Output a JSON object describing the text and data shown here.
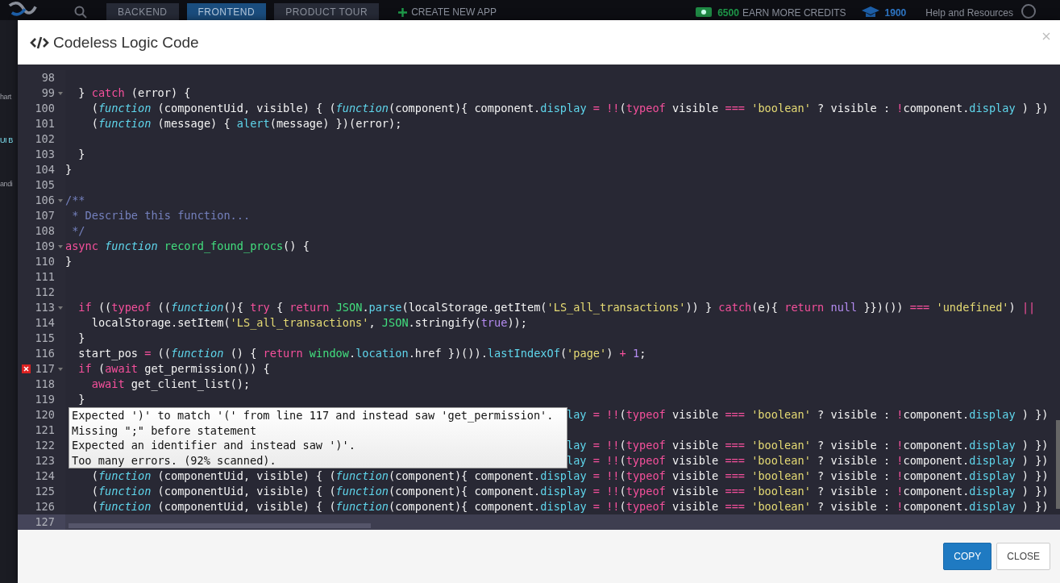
{
  "topbar": {
    "tabs": [
      {
        "label": "BACKEND",
        "selected": false
      },
      {
        "label": "FRONTEND",
        "selected": true
      },
      {
        "label": "PRODUCT TOUR",
        "selected": false
      }
    ],
    "create": "CREATE NEW APP",
    "credits": "6500",
    "earn": "EARN MORE CREDITS",
    "points": "1900",
    "help": "Help and Resources"
  },
  "sidebar": [
    {
      "label": "hart",
      "selected": false
    },
    {
      "label": "UI B",
      "selected": true
    },
    {
      "label": "andi",
      "selected": false
    }
  ],
  "dialog": {
    "title": "Codeless Logic Code",
    "lines": [
      {
        "num": "98"
      },
      {
        "num": "99",
        "fold": true,
        "tokens": [
          {
            "kind": "plain",
            "text": "  } "
          },
          {
            "kind": "keyword",
            "text": "catch"
          },
          {
            "kind": "plain",
            "text": " (error) {"
          }
        ]
      },
      {
        "num": "100",
        "tokens": [
          {
            "kind": "plain",
            "text": "    ("
          },
          {
            "kind": "function",
            "text": "function"
          },
          {
            "kind": "plain",
            "text": " (componentUid, visible) { ("
          },
          {
            "kind": "function",
            "text": "function"
          },
          {
            "kind": "plain",
            "text": "(component){ component."
          },
          {
            "kind": "builtin",
            "text": "display"
          },
          {
            "kind": "keyword",
            "text": " = !!"
          },
          {
            "kind": "plain",
            "text": "("
          },
          {
            "kind": "keyword",
            "text": "typeof"
          },
          {
            "kind": "plain",
            "text": " visible "
          },
          {
            "kind": "keyword",
            "text": "=== "
          },
          {
            "kind": "string",
            "text": "'boolean'"
          },
          {
            "kind": "plain",
            "text": " ? visible : "
          },
          {
            "kind": "keyword",
            "text": "!"
          },
          {
            "kind": "plain",
            "text": "component."
          },
          {
            "kind": "builtin",
            "text": "display"
          },
          {
            "kind": "plain",
            "text": " ) })"
          }
        ]
      },
      {
        "num": "101",
        "tokens": [
          {
            "kind": "plain",
            "text": "    ("
          },
          {
            "kind": "function",
            "text": "function"
          },
          {
            "kind": "plain",
            "text": " (message) { "
          },
          {
            "kind": "builtin",
            "text": "alert"
          },
          {
            "kind": "plain",
            "text": "(message) })(error);"
          }
        ]
      },
      {
        "num": "102"
      },
      {
        "num": "103",
        "tokens": [
          {
            "kind": "plain",
            "text": "  }"
          }
        ]
      },
      {
        "num": "104",
        "tokens": [
          {
            "kind": "plain",
            "text": "}"
          }
        ]
      },
      {
        "num": "105"
      },
      {
        "num": "106",
        "fold": true,
        "tokens": [
          {
            "kind": "comment",
            "text": "/**"
          }
        ]
      },
      {
        "num": "107",
        "tokens": [
          {
            "kind": "comment",
            "text": " * Describe this function..."
          }
        ]
      },
      {
        "num": "108",
        "tokens": [
          {
            "kind": "comment",
            "text": " */"
          }
        ]
      },
      {
        "num": "109",
        "fold": true,
        "tokens": [
          {
            "kind": "keyword",
            "text": "async "
          },
          {
            "kind": "function",
            "text": "function "
          },
          {
            "kind": "name",
            "text": "record_found_procs"
          },
          {
            "kind": "plain",
            "text": "() {"
          }
        ]
      },
      {
        "num": "110",
        "tokens": [
          {
            "kind": "plain",
            "text": "}"
          }
        ]
      },
      {
        "num": "111"
      },
      {
        "num": "112"
      },
      {
        "num": "113",
        "fold": true,
        "tokens": [
          {
            "kind": "keyword",
            "text": "  if"
          },
          {
            "kind": "plain",
            "text": " (("
          },
          {
            "kind": "keyword",
            "text": "typeof"
          },
          {
            "kind": "plain",
            "text": " (("
          },
          {
            "kind": "function",
            "text": "function"
          },
          {
            "kind": "plain",
            "text": "(){ "
          },
          {
            "kind": "keyword",
            "text": "try"
          },
          {
            "kind": "plain",
            "text": " { "
          },
          {
            "kind": "keyword",
            "text": "return "
          },
          {
            "kind": "name",
            "text": "JSON"
          },
          {
            "kind": "plain",
            "text": "."
          },
          {
            "kind": "builtin",
            "text": "parse"
          },
          {
            "kind": "plain",
            "text": "(localStorage.getItem("
          },
          {
            "kind": "string",
            "text": "'LS_all_transactions'"
          },
          {
            "kind": "plain",
            "text": ")) } "
          },
          {
            "kind": "keyword",
            "text": "catch"
          },
          {
            "kind": "plain",
            "text": "(e){ "
          },
          {
            "kind": "keyword",
            "text": "return "
          },
          {
            "kind": "constant",
            "text": "null"
          },
          {
            "kind": "plain",
            "text": " }})()) "
          },
          {
            "kind": "keyword",
            "text": "=== "
          },
          {
            "kind": "string",
            "text": "'undefined'"
          },
          {
            "kind": "plain",
            "text": ") "
          },
          {
            "kind": "keyword",
            "text": "||"
          }
        ]
      },
      {
        "num": "114",
        "tokens": [
          {
            "kind": "plain",
            "text": "    localStorage.setItem("
          },
          {
            "kind": "string",
            "text": "'LS_all_transactions'"
          },
          {
            "kind": "plain",
            "text": ", "
          },
          {
            "kind": "name",
            "text": "JSON"
          },
          {
            "kind": "plain",
            "text": ".stringify("
          },
          {
            "kind": "constant",
            "text": "true"
          },
          {
            "kind": "plain",
            "text": "));"
          }
        ]
      },
      {
        "num": "115",
        "tokens": [
          {
            "kind": "plain",
            "text": "  }"
          }
        ]
      },
      {
        "num": "116",
        "tokens": [
          {
            "kind": "plain",
            "text": "  start_pos "
          },
          {
            "kind": "keyword",
            "text": "="
          },
          {
            "kind": "plain",
            "text": " (("
          },
          {
            "kind": "function",
            "text": "function"
          },
          {
            "kind": "plain",
            "text": " () { "
          },
          {
            "kind": "keyword",
            "text": "return "
          },
          {
            "kind": "name",
            "text": "window"
          },
          {
            "kind": "plain",
            "text": "."
          },
          {
            "kind": "builtin",
            "text": "location"
          },
          {
            "kind": "plain",
            "text": ".href })())."
          },
          {
            "kind": "builtin",
            "text": "lastIndexOf"
          },
          {
            "kind": "plain",
            "text": "("
          },
          {
            "kind": "string",
            "text": "'page'"
          },
          {
            "kind": "plain",
            "text": ") "
          },
          {
            "kind": "keyword",
            "text": "+ "
          },
          {
            "kind": "constant",
            "text": "1"
          },
          {
            "kind": "plain",
            "text": ";"
          }
        ]
      },
      {
        "num": "117",
        "fold": true,
        "error": true,
        "tokens": [
          {
            "kind": "keyword",
            "text": "  if"
          },
          {
            "kind": "plain",
            "text": " ("
          },
          {
            "kind": "keyword",
            "text": "await"
          },
          {
            "kind": "plain",
            "text": " get_permission()) {"
          }
        ]
      },
      {
        "num": "118",
        "tokens": [
          {
            "kind": "keyword",
            "text": "    await"
          },
          {
            "kind": "plain",
            "text": " get_client_list();"
          }
        ]
      },
      {
        "num": "119",
        "tokens": [
          {
            "kind": "plain",
            "text": "  }"
          }
        ]
      },
      {
        "num": "120",
        "covered": true,
        "tokens": [
          {
            "kind": "builtin",
            "text": "lay"
          },
          {
            "kind": "keyword",
            "text": " = !!"
          },
          {
            "kind": "plain",
            "text": "("
          },
          {
            "kind": "keyword",
            "text": "typeof"
          },
          {
            "kind": "plain",
            "text": " visible "
          },
          {
            "kind": "keyword",
            "text": "=== "
          },
          {
            "kind": "string",
            "text": "'boolean'"
          },
          {
            "kind": "plain",
            "text": " ? visible : "
          },
          {
            "kind": "keyword",
            "text": "!"
          },
          {
            "kind": "plain",
            "text": "component."
          },
          {
            "kind": "builtin",
            "text": "display"
          },
          {
            "kind": "plain",
            "text": " ) })"
          }
        ]
      },
      {
        "num": "121"
      },
      {
        "num": "122",
        "covered": true,
        "tokens": [
          {
            "kind": "builtin",
            "text": "lay"
          },
          {
            "kind": "keyword",
            "text": " = !!"
          },
          {
            "kind": "plain",
            "text": "("
          },
          {
            "kind": "keyword",
            "text": "typeof"
          },
          {
            "kind": "plain",
            "text": " visible "
          },
          {
            "kind": "keyword",
            "text": "=== "
          },
          {
            "kind": "string",
            "text": "'boolean'"
          },
          {
            "kind": "plain",
            "text": " ? visible : "
          },
          {
            "kind": "keyword",
            "text": "!"
          },
          {
            "kind": "plain",
            "text": "component."
          },
          {
            "kind": "builtin",
            "text": "display"
          },
          {
            "kind": "plain",
            "text": " ) })"
          }
        ]
      },
      {
        "num": "123",
        "covered": true,
        "tokens": [
          {
            "kind": "builtin",
            "text": "lay"
          },
          {
            "kind": "keyword",
            "text": " = !!"
          },
          {
            "kind": "plain",
            "text": "("
          },
          {
            "kind": "keyword",
            "text": "typeof"
          },
          {
            "kind": "plain",
            "text": " visible "
          },
          {
            "kind": "keyword",
            "text": "=== "
          },
          {
            "kind": "string",
            "text": "'boolean'"
          },
          {
            "kind": "plain",
            "text": " ? visible : "
          },
          {
            "kind": "keyword",
            "text": "!"
          },
          {
            "kind": "plain",
            "text": "component."
          },
          {
            "kind": "builtin",
            "text": "display"
          },
          {
            "kind": "plain",
            "text": " ) })"
          }
        ]
      },
      {
        "num": "124",
        "tokens": [
          {
            "kind": "plain",
            "text": "    ("
          },
          {
            "kind": "function",
            "text": "function"
          },
          {
            "kind": "plain",
            "text": " (componentUid, visible) { ("
          },
          {
            "kind": "function",
            "text": "function"
          },
          {
            "kind": "plain",
            "text": "(component){ component."
          },
          {
            "kind": "builtin",
            "text": "display"
          },
          {
            "kind": "keyword",
            "text": " = !!"
          },
          {
            "kind": "plain",
            "text": "("
          },
          {
            "kind": "keyword",
            "text": "typeof"
          },
          {
            "kind": "plain",
            "text": " visible "
          },
          {
            "kind": "keyword",
            "text": "=== "
          },
          {
            "kind": "string",
            "text": "'boolean'"
          },
          {
            "kind": "plain",
            "text": " ? visible : "
          },
          {
            "kind": "keyword",
            "text": "!"
          },
          {
            "kind": "plain",
            "text": "component."
          },
          {
            "kind": "builtin",
            "text": "display"
          },
          {
            "kind": "plain",
            "text": " ) })"
          }
        ]
      },
      {
        "num": "125",
        "tokens": [
          {
            "kind": "plain",
            "text": "    ("
          },
          {
            "kind": "function",
            "text": "function"
          },
          {
            "kind": "plain",
            "text": " (componentUid, visible) { ("
          },
          {
            "kind": "function",
            "text": "function"
          },
          {
            "kind": "plain",
            "text": "(component){ component."
          },
          {
            "kind": "builtin",
            "text": "display"
          },
          {
            "kind": "keyword",
            "text": " = !!"
          },
          {
            "kind": "plain",
            "text": "("
          },
          {
            "kind": "keyword",
            "text": "typeof"
          },
          {
            "kind": "plain",
            "text": " visible "
          },
          {
            "kind": "keyword",
            "text": "=== "
          },
          {
            "kind": "string",
            "text": "'boolean'"
          },
          {
            "kind": "plain",
            "text": " ? visible : "
          },
          {
            "kind": "keyword",
            "text": "!"
          },
          {
            "kind": "plain",
            "text": "component."
          },
          {
            "kind": "builtin",
            "text": "display"
          },
          {
            "kind": "plain",
            "text": " ) })"
          }
        ]
      },
      {
        "num": "126",
        "tokens": [
          {
            "kind": "plain",
            "text": "    ("
          },
          {
            "kind": "function",
            "text": "function"
          },
          {
            "kind": "plain",
            "text": " (componentUid, visible) { ("
          },
          {
            "kind": "function",
            "text": "function"
          },
          {
            "kind": "plain",
            "text": "(component){ component."
          },
          {
            "kind": "builtin",
            "text": "display"
          },
          {
            "kind": "keyword",
            "text": " = !!"
          },
          {
            "kind": "plain",
            "text": "("
          },
          {
            "kind": "keyword",
            "text": "typeof"
          },
          {
            "kind": "plain",
            "text": " visible "
          },
          {
            "kind": "keyword",
            "text": "=== "
          },
          {
            "kind": "string",
            "text": "'boolean'"
          },
          {
            "kind": "plain",
            "text": " ? visible : "
          },
          {
            "kind": "keyword",
            "text": "!"
          },
          {
            "kind": "plain",
            "text": "component."
          },
          {
            "kind": "builtin",
            "text": "display"
          },
          {
            "kind": "plain",
            "text": " ) })"
          }
        ]
      },
      {
        "num": "127",
        "active": true
      }
    ],
    "tooltip": [
      "Expected ')' to match '(' from line 117 and instead saw 'get_permission'.",
      "Missing \";\" before statement",
      "Expected an identifier and instead saw ')'.",
      "Too many errors. (92% scanned)."
    ],
    "buttons": [
      {
        "label": "COPY",
        "kind": "primary"
      },
      {
        "label": "CLOSE",
        "kind": "secondary"
      }
    ]
  }
}
